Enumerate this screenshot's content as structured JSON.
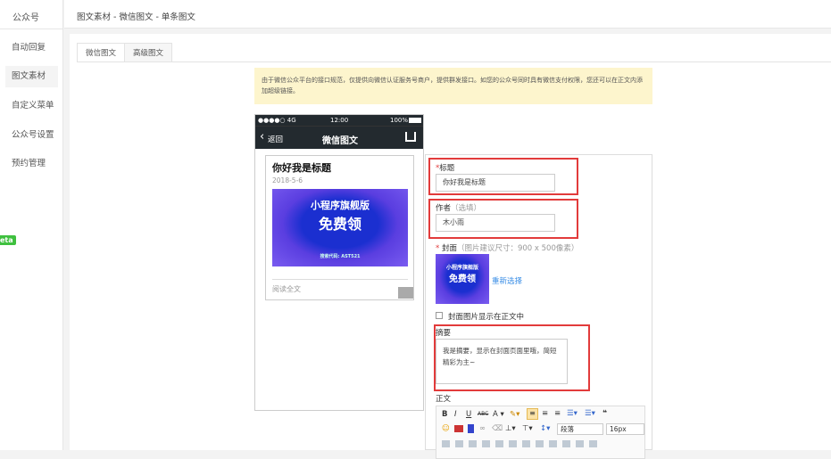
{
  "sidebar": {
    "brand": "公众号",
    "items": [
      {
        "label": "自动回复"
      },
      {
        "label": "图文素材"
      },
      {
        "label": "自定义菜单"
      },
      {
        "label": "公众号设置"
      },
      {
        "label": "预约管理"
      }
    ],
    "badge": "eta"
  },
  "header": {
    "breadcrumb": "图文素材 - 微信图文 - 单条图文"
  },
  "tabs": [
    {
      "label": "微信图文"
    },
    {
      "label": "高级图文"
    }
  ],
  "notice": "由于微信公众平台的接口规范，仅提供向微信认证服务号商户，提供群发接口。如您的公众号同时具有微信支付权限，您还可以在正文内添加超级链接。",
  "phone": {
    "signal": "●●●●○ 4G",
    "time": "12:00",
    "battery": "100%",
    "back": "返回",
    "title": "微信图文",
    "card": {
      "title": "你好我是标题",
      "date": "2018-5-6",
      "cover_line1": "小程序旗舰版",
      "cover_line2": "免费领",
      "cover_small": "搜索代码: AST521",
      "read_more": "阅读全文"
    }
  },
  "form": {
    "title_label": "标题",
    "required": "*",
    "title_value": "你好我是标题",
    "author_label": "作者",
    "author_hint": "（选填）",
    "author_value": "木小雨",
    "cover_label": "封面",
    "cover_hint": "（图片建议尺寸：900 x 500像素）",
    "reselect": "重新选择",
    "show_cover_label": "封面图片显示在正文中",
    "summary_label": "摘要",
    "summary_value": "我是摘要，显示在封面页面里哦，简短精彩为主~",
    "body_label": "正文",
    "editor": {
      "paragraph": "段落",
      "font_size": "16px"
    }
  }
}
